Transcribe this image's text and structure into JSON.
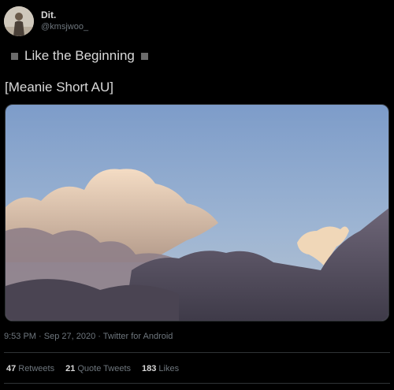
{
  "author": {
    "display_name": "Dit.",
    "handle": "@kmsjwoo_"
  },
  "tweet": {
    "line1": "Like the Beginning",
    "line2": "[Meanie Short AU]",
    "timestamp": "9:53 PM · Sep 27, 2020 · Twitter for Android"
  },
  "stats": {
    "retweets_count": "47",
    "retweets_label": "Retweets",
    "quote_count": "21",
    "quote_label": "Quote Tweets",
    "likes_count": "183",
    "likes_label": "Likes"
  },
  "colors": {
    "background": "#000000",
    "text": "#d9d9d9",
    "secondary_text": "#6e767d",
    "divider": "#2f3336"
  }
}
